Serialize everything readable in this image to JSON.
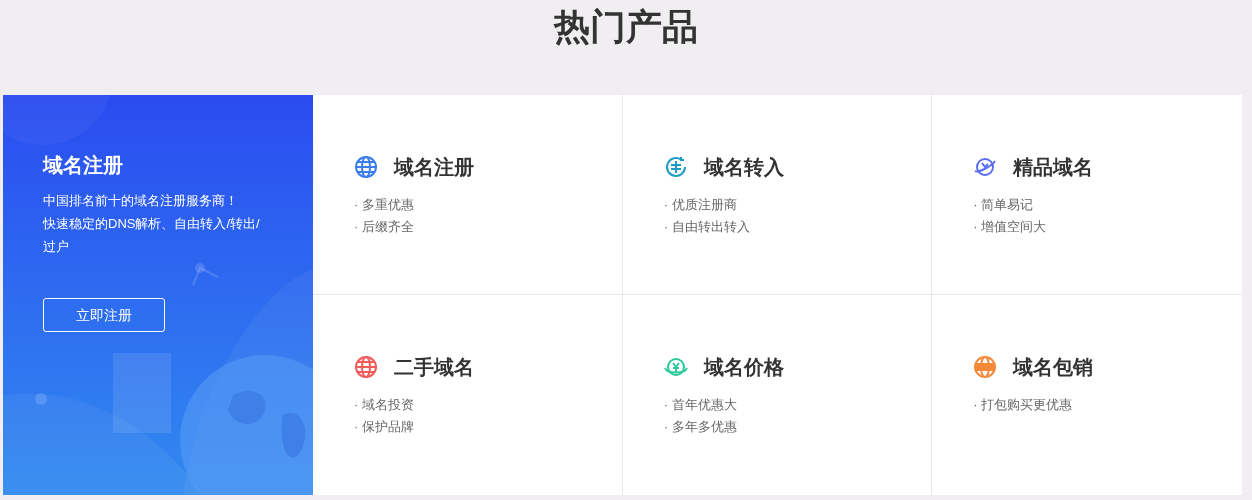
{
  "title": "热门产品",
  "banner": {
    "kind": "picture",
    "heading": "域名注册",
    "description": [
      "中国排名前十的域名注册服务商！",
      "快速稳定的DNS解析、自由转入/转出/",
      "过户"
    ],
    "button": "立即注册"
  },
  "products": [
    {
      "kind": "globe",
      "color": "#3b7ded",
      "name": "域名注册",
      "features": [
        "· 多重优惠",
        "· 后缀齐全"
      ]
    },
    {
      "kind": "transfer",
      "color": "#1e9bc4",
      "name": "域名转入",
      "features": [
        "· 优质注册商",
        "· 自由转出转入"
      ]
    },
    {
      "kind": "planet",
      "color": "#5a6cf0",
      "name": "精品域名",
      "features": [
        "· 简单易记",
        "· 增值空间大"
      ]
    },
    {
      "kind": "globe",
      "color": "#f45b5b",
      "name": "二手域名",
      "features": [
        "· 域名投资",
        "· 保护品牌"
      ]
    },
    {
      "kind": "yen",
      "color": "#2ec99a",
      "name": "域名价格",
      "features": [
        "· 首年优惠大",
        "· 多年多优惠"
      ]
    },
    {
      "kind": "www",
      "color": "#f7893b",
      "name": "域名包销",
      "features": [
        "· 打包购买更优惠"
      ]
    }
  ]
}
